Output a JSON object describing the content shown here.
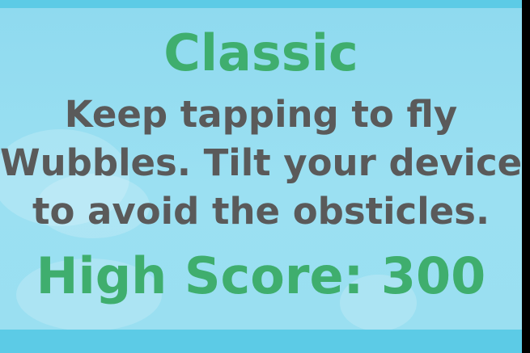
{
  "game": {
    "mode_title": "Classic",
    "description_lines": [
      "Keep tapping to fly",
      "Wubbles. Tilt your device",
      "to avoid the obsticles."
    ],
    "high_score_text": "High Score: 300"
  },
  "colors": {
    "title_green": "#3fae6e",
    "description_gray": "#5a5a5a",
    "sky_blue": "#9be0f2",
    "frame_blue": "#5ccbe6"
  }
}
